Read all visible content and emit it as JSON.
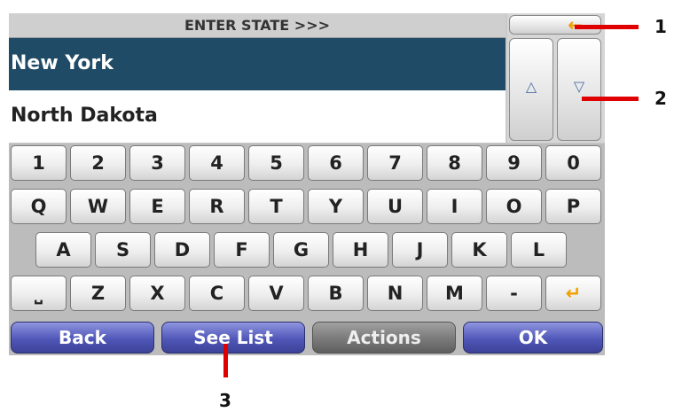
{
  "title": "ENTER STATE >>>",
  "results": [
    "New York",
    "North Dakota"
  ],
  "controls": {
    "backspace": "←",
    "up": "△",
    "down": "▽"
  },
  "keyboard": {
    "row1": [
      "1",
      "2",
      "3",
      "4",
      "5",
      "6",
      "7",
      "8",
      "9",
      "0"
    ],
    "row2": [
      "Q",
      "W",
      "E",
      "R",
      "T",
      "Y",
      "U",
      "I",
      "O",
      "P"
    ],
    "row3": [
      "A",
      "S",
      "D",
      "F",
      "G",
      "H",
      "J",
      "K",
      "L"
    ],
    "row4": [
      "⎵",
      "Z",
      "X",
      "C",
      "V",
      "B",
      "N",
      "M",
      "-",
      "↵"
    ]
  },
  "bottom_bar": {
    "back": "Back",
    "see_list": "See List",
    "actions": "Actions",
    "ok": "OK"
  },
  "callouts": [
    "1",
    "2",
    "3"
  ],
  "colors": {
    "selected_row": "#1f4b66",
    "button_blue": "#5057b8",
    "callout_red": "#e00000",
    "enter_orange": "#f0a000"
  }
}
